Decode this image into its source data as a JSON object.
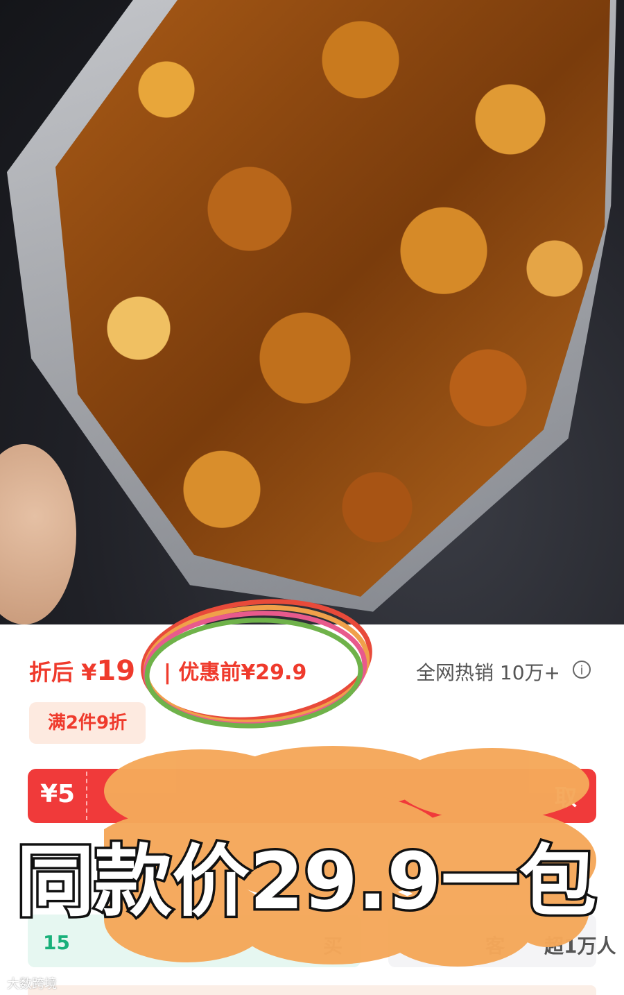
{
  "product": {
    "image_alt": "Honey glazed walnut kernels in a clear bag"
  },
  "price": {
    "label": "折后",
    "currency": "¥",
    "partial": "19",
    "separator": "|",
    "original_label": "优惠前",
    "original_price": "¥29.9"
  },
  "sales": {
    "text": "全网热销 10万+",
    "icon": "info-icon",
    "icon_glyph": "i"
  },
  "promo": {
    "label": "满2件9折"
  },
  "coupon": {
    "amount": "¥5",
    "claim": "取"
  },
  "overlay": {
    "title": "同款价29.9一包"
  },
  "cards": {
    "left_text": "15",
    "left_text2": "买",
    "right_text": "客",
    "right_text2": "超1万人"
  },
  "watermark": {
    "text": "大数跨境"
  },
  "colors": {
    "price_red": "#ef3a2c",
    "coupon_red": "#f03a3a",
    "scribble_orange": "#f5a85a",
    "circle_green": "#6fb24a",
    "circle_pink": "#e85a8c",
    "circle_orange": "#f0a04a",
    "circle_red": "#e84a3a"
  }
}
